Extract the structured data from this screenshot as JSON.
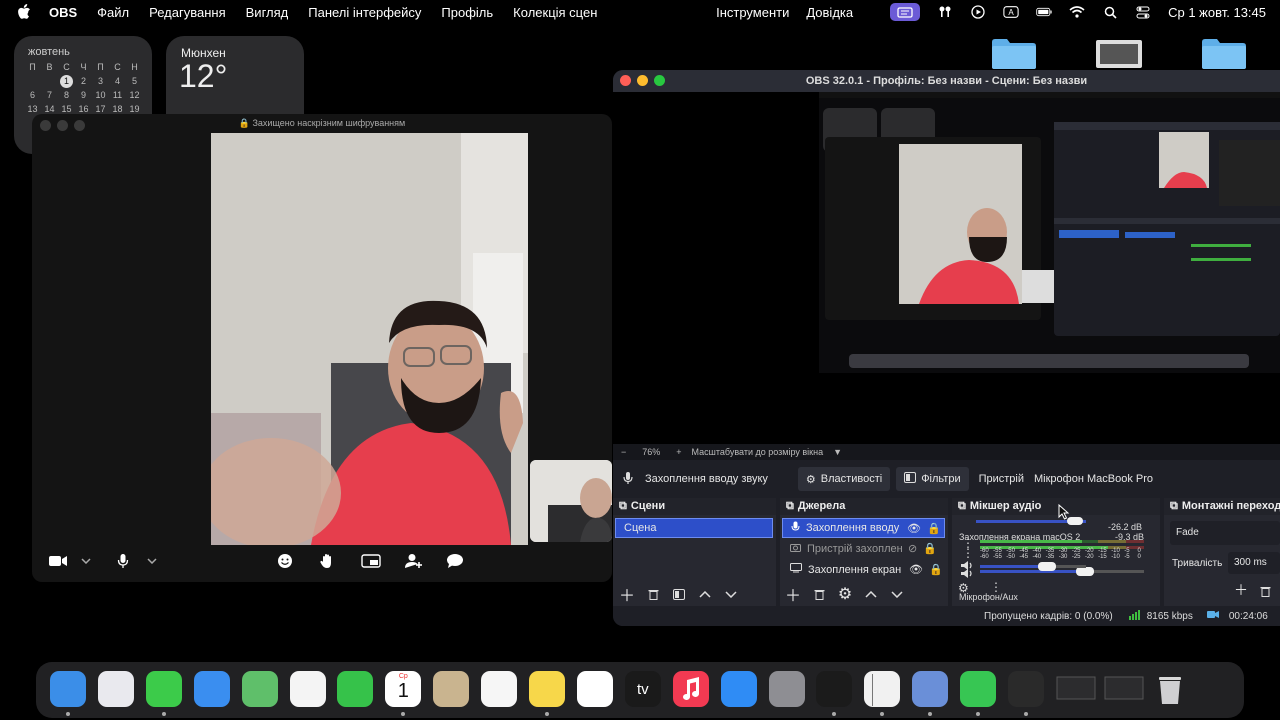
{
  "menubar": {
    "app_name": "OBS",
    "items": [
      "Файл",
      "Редагування",
      "Вигляд",
      "Панелі інтерфейсу",
      "Профіль",
      "Колекція сцен"
    ],
    "right_items": [
      "Інструменти",
      "Довідка"
    ],
    "clock": "Ср 1 жовт.  13:45",
    "icons": [
      "screen-share-icon",
      "airpods-icon",
      "play-icon",
      "input-source-icon",
      "battery-icon",
      "wifi-icon",
      "search-icon",
      "control-center-icon"
    ]
  },
  "calendar": {
    "month": "жовтень",
    "weekdays": [
      "П",
      "В",
      "С",
      "Ч",
      "П",
      "С",
      "Н"
    ],
    "days": [
      "",
      "",
      "1",
      "2",
      "3",
      "4",
      "5",
      "6",
      "7",
      "8",
      "9",
      "10",
      "11",
      "12",
      "13",
      "14",
      "15",
      "16",
      "17",
      "18",
      "19"
    ],
    "today": "1"
  },
  "weather": {
    "city": "Мюнхен",
    "temp": "12°"
  },
  "facetime": {
    "secure_label": "Захищено наскрізним шифруванням",
    "controls": [
      "camera-icon",
      "chevron-down-icon",
      "microphone-icon",
      "chevron-down-icon",
      "emoji-icon",
      "raise-hand-icon",
      "screen-share-icon",
      "add-person-icon",
      "message-icon"
    ]
  },
  "obs": {
    "title": "OBS 32.0.1 - Профіль: Без назви - Сцени: Без назви",
    "zoom": {
      "minus": "−",
      "value": "76%",
      "plus": "+",
      "fit_label": "Масштабувати до розміру вікна"
    },
    "source_bar": {
      "source_name": "Захоплення вводу звуку",
      "properties": "Властивості",
      "filters": "Фільтри",
      "device_label": "Пристрій",
      "device_value": "Мікрофон MacBook Pro"
    },
    "scenes": {
      "title": "Сцени",
      "items": [
        "Сцена"
      ]
    },
    "sources": {
      "title": "Джерела",
      "items": [
        {
          "name": "Захоплення вводу",
          "icon": "microphone-icon"
        },
        {
          "name": "Пристрій захоплен",
          "icon": "camera-icon"
        },
        {
          "name": "Захоплення екран",
          "icon": "display-icon"
        }
      ]
    },
    "mixer": {
      "title": "Мікшер аудіо",
      "channels": [
        {
          "name": "Захоплення екрана macOS 2",
          "db": "-9.3 dB",
          "level": 0.78
        },
        {
          "name": "Мікрофон/Aux",
          "db": "-26.2 dB",
          "level": 0.62
        }
      ],
      "scale": [
        "-60",
        "-55",
        "-50",
        "-45",
        "-40",
        "-35",
        "-30",
        "-25",
        "-20",
        "-15",
        "-10",
        "-5",
        "0"
      ]
    },
    "transitions": {
      "title": "Монтажні переходи",
      "type": "Fade",
      "duration_label": "Тривалість",
      "duration_value": "300 ms"
    },
    "status": {
      "dropped": "Пропущено кадрів: 0 (0.0%)",
      "bitrate": "8165 kbps",
      "time": "00:24:06"
    }
  },
  "dock": {
    "apps": [
      "finder-icon",
      "launchpad-icon",
      "messages-icon",
      "mail-icon",
      "maps-icon",
      "photos-icon",
      "facetime-icon",
      "calendar-icon",
      "contacts-icon",
      "reminders-icon",
      "notes-icon",
      "freeform-icon",
      "tv-icon",
      "music-icon",
      "app-store-icon",
      "settings-icon",
      "chatgpt-icon",
      "chrome-icon",
      "finder-alt-icon",
      "whatsapp-icon",
      "obs-icon",
      "window-thumb-icon",
      "window-thumb-icon",
      "trash-icon"
    ],
    "calendar_day": "1",
    "calendar_weekday": "Ср",
    "tv_label": "tv"
  }
}
